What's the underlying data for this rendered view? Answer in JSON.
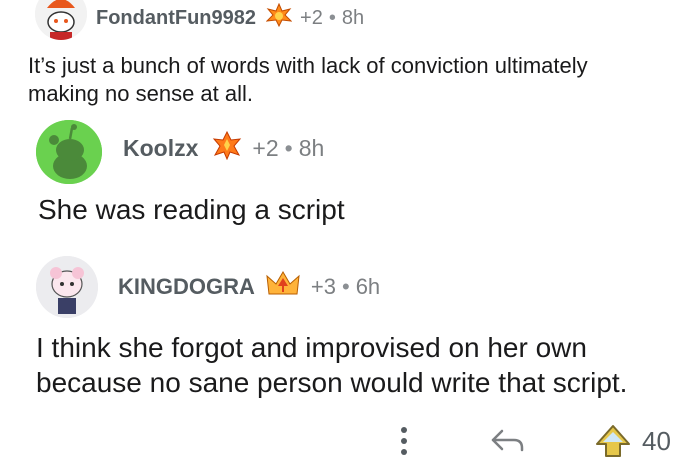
{
  "comments": [
    {
      "username": "FondantFun9982",
      "awards": "+2",
      "time": "8h",
      "body": "It’s just a bunch of words with lack of conviction ultimately making no sense at all."
    },
    {
      "username": "Koolzx",
      "awards": "+2",
      "time": "8h",
      "body": "She was reading a script"
    },
    {
      "username": "KINGDOGRA",
      "awards": "+3",
      "time": "6h",
      "body": "I think she forgot and improvised on her own because no sane person would write that script."
    }
  ],
  "separator": "•",
  "actions": {
    "more_icon": "vertical-ellipsis-icon",
    "reply_icon": "reply-arrow-icon",
    "upvote_icon": "upvote-award-icon",
    "vote_count": "40"
  },
  "colors": {
    "text": "#1a1a1b",
    "meta": "#7c7f82",
    "avatar_green": "#6ad14f"
  }
}
